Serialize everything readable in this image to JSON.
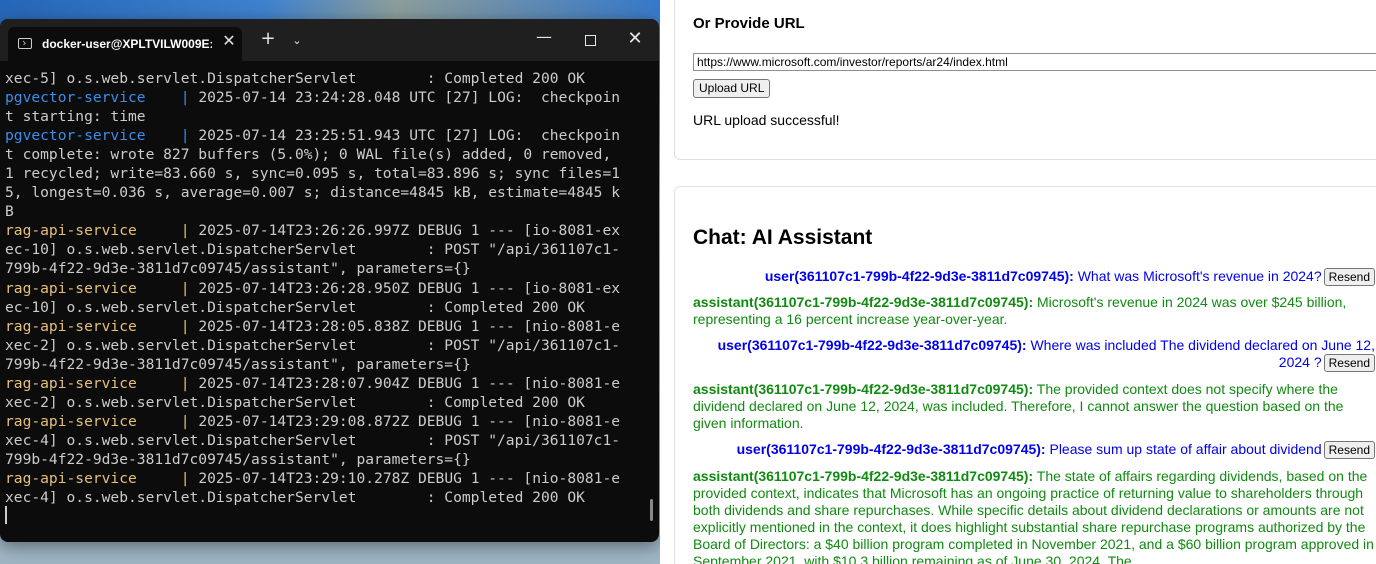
{
  "terminal": {
    "tab_title": "docker-user@XPLTVILW009E:",
    "tab_close": "✕",
    "new_tab": "+",
    "tab_menu": "⌄",
    "min": "—",
    "close": "✕",
    "lines": [
      {
        "parts": [
          {
            "t": "xec-5] o.s.web.servlet.DispatcherServlet        : Completed 200 OK",
            "c": ""
          }
        ]
      },
      {
        "parts": [
          {
            "t": "pgvector-service",
            "c": "svc-pg"
          },
          {
            "t": "    ",
            "c": ""
          },
          {
            "t": "|",
            "c": "bar-blue"
          },
          {
            "t": " 2025-07-14 23:24:28.048 UTC [27] LOG:  checkpoin",
            "c": ""
          }
        ]
      },
      {
        "parts": [
          {
            "t": "t starting: time",
            "c": ""
          }
        ]
      },
      {
        "parts": [
          {
            "t": "pgvector-service",
            "c": "svc-pg"
          },
          {
            "t": "    ",
            "c": ""
          },
          {
            "t": "|",
            "c": "bar-blue"
          },
          {
            "t": " 2025-07-14 23:25:51.943 UTC [27] LOG:  checkpoin",
            "c": ""
          }
        ]
      },
      {
        "parts": [
          {
            "t": "t complete: wrote 827 buffers (5.0%); 0 WAL file(s) added, 0 removed,",
            "c": ""
          }
        ]
      },
      {
        "parts": [
          {
            "t": "1 recycled; write=83.660 s, sync=0.095 s, total=83.896 s; sync files=1",
            "c": ""
          }
        ]
      },
      {
        "parts": [
          {
            "t": "5, longest=0.036 s, average=0.007 s; distance=4845 kB, estimate=4845 k",
            "c": ""
          }
        ]
      },
      {
        "parts": [
          {
            "t": "B",
            "c": ""
          }
        ]
      },
      {
        "parts": [
          {
            "t": "rag-api-service",
            "c": "svc-rag"
          },
          {
            "t": "     ",
            "c": ""
          },
          {
            "t": "|",
            "c": "bar-yellow"
          },
          {
            "t": " 2025-07-14T23:26:26.997Z DEBUG 1 --- [io-8081-ex",
            "c": ""
          }
        ]
      },
      {
        "parts": [
          {
            "t": "ec-10] o.s.web.servlet.DispatcherServlet        : POST \"/api/361107c1-",
            "c": ""
          }
        ]
      },
      {
        "parts": [
          {
            "t": "799b-4f22-9d3e-3811d7c09745/assistant\", parameters={}",
            "c": ""
          }
        ]
      },
      {
        "parts": [
          {
            "t": "rag-api-service",
            "c": "svc-rag"
          },
          {
            "t": "     ",
            "c": ""
          },
          {
            "t": "|",
            "c": "bar-yellow"
          },
          {
            "t": " 2025-07-14T23:26:28.950Z DEBUG 1 --- [io-8081-ex",
            "c": ""
          }
        ]
      },
      {
        "parts": [
          {
            "t": "ec-10] o.s.web.servlet.DispatcherServlet        : Completed 200 OK",
            "c": ""
          }
        ]
      },
      {
        "parts": [
          {
            "t": "rag-api-service",
            "c": "svc-rag"
          },
          {
            "t": "     ",
            "c": ""
          },
          {
            "t": "|",
            "c": "bar-yellow"
          },
          {
            "t": " 2025-07-14T23:28:05.838Z DEBUG 1 --- [nio-8081-e",
            "c": ""
          }
        ]
      },
      {
        "parts": [
          {
            "t": "xec-2] o.s.web.servlet.DispatcherServlet        : POST \"/api/361107c1-",
            "c": ""
          }
        ]
      },
      {
        "parts": [
          {
            "t": "799b-4f22-9d3e-3811d7c09745/assistant\", parameters={}",
            "c": ""
          }
        ]
      },
      {
        "parts": [
          {
            "t": "rag-api-service",
            "c": "svc-rag"
          },
          {
            "t": "     ",
            "c": ""
          },
          {
            "t": "|",
            "c": "bar-yellow"
          },
          {
            "t": " 2025-07-14T23:28:07.904Z DEBUG 1 --- [nio-8081-e",
            "c": ""
          }
        ]
      },
      {
        "parts": [
          {
            "t": "xec-2] o.s.web.servlet.DispatcherServlet        : Completed 200 OK",
            "c": ""
          }
        ]
      },
      {
        "parts": [
          {
            "t": "rag-api-service",
            "c": "svc-rag"
          },
          {
            "t": "     ",
            "c": ""
          },
          {
            "t": "|",
            "c": "bar-yellow"
          },
          {
            "t": " 2025-07-14T23:29:08.872Z DEBUG 1 --- [nio-8081-e",
            "c": ""
          }
        ]
      },
      {
        "parts": [
          {
            "t": "xec-4] o.s.web.servlet.DispatcherServlet        : POST \"/api/361107c1-",
            "c": ""
          }
        ]
      },
      {
        "parts": [
          {
            "t": "799b-4f22-9d3e-3811d7c09745/assistant\", parameters={}",
            "c": ""
          }
        ]
      },
      {
        "parts": [
          {
            "t": "rag-api-service",
            "c": "svc-rag"
          },
          {
            "t": "     ",
            "c": ""
          },
          {
            "t": "|",
            "c": "bar-yellow"
          },
          {
            "t": " 2025-07-14T23:29:10.278Z DEBUG 1 --- [nio-8081-e",
            "c": ""
          }
        ]
      },
      {
        "parts": [
          {
            "t": "xec-4] o.s.web.servlet.DispatcherServlet        : Completed 200 OK",
            "c": ""
          }
        ]
      }
    ]
  },
  "url_section": {
    "heading": "Or Provide URL",
    "url_value": "https://www.microsoft.com/investor/reports/ar24/index.html",
    "upload_button": "Upload URL",
    "status": "URL upload successful!"
  },
  "chat": {
    "title": "Chat: AI Assistant",
    "resend_label": "Resend",
    "messages": [
      {
        "role": "user",
        "who": "user(361107c1-799b-4f22-9d3e-3811d7c09745):",
        "text": "What was Microsoft's revenue in 2024?"
      },
      {
        "role": "assistant",
        "who": "assistant(361107c1-799b-4f22-9d3e-3811d7c09745):",
        "text": "Microsoft's revenue in 2024 was over $245 billion, representing a 16 percent increase year-over-year."
      },
      {
        "role": "user",
        "who": "user(361107c1-799b-4f22-9d3e-3811d7c09745):",
        "text": "Where was included The dividend declared on June 12, 2024 ?"
      },
      {
        "role": "assistant",
        "who": "assistant(361107c1-799b-4f22-9d3e-3811d7c09745):",
        "text": "The provided context does not specify where the dividend declared on June 12, 2024, was included. Therefore, I cannot answer the question based on the given information."
      },
      {
        "role": "user",
        "who": "user(361107c1-799b-4f22-9d3e-3811d7c09745):",
        "text": "Please sum up state of affair about dividend"
      },
      {
        "role": "assistant",
        "who": "assistant(361107c1-799b-4f22-9d3e-3811d7c09745):",
        "text": "The state of affairs regarding dividends, based on the provided context, indicates that Microsoft has an ongoing practice of returning value to shareholders through both dividends and share repurchases. While specific details about dividend declarations or amounts are not explicitly mentioned in the context, it does highlight substantial share repurchase programs authorized by the Board of Directors: a $40 billion program completed in November 2021, and a $60 billion program approved in September 2021, with $10.3 billion remaining as of June 30, 2024. The"
      }
    ]
  }
}
